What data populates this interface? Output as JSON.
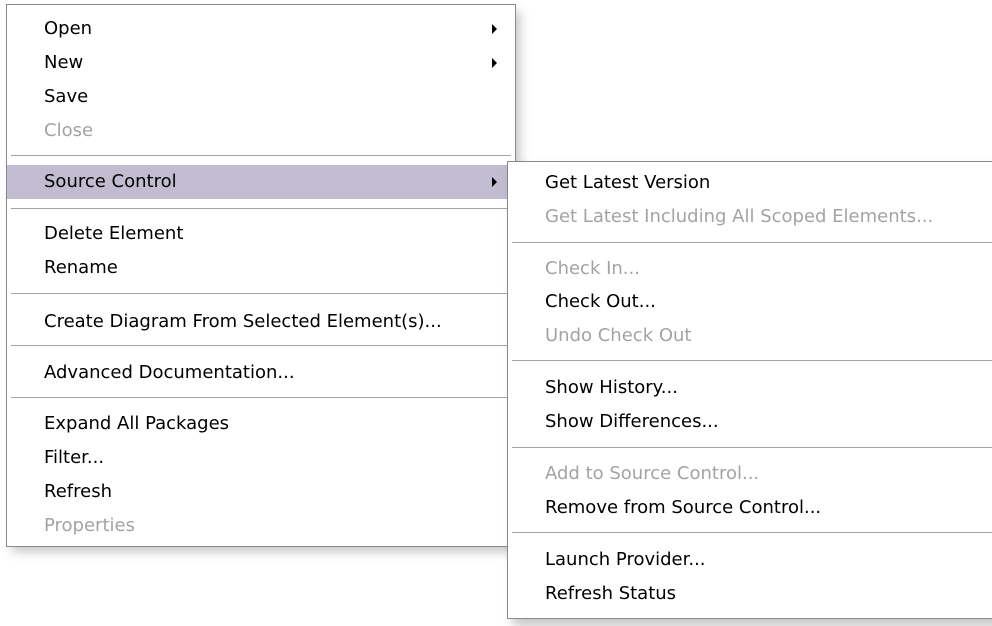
{
  "main_menu": {
    "items": [
      {
        "label": "Open",
        "disabled": false,
        "submenu": true
      },
      {
        "label": "New",
        "disabled": false,
        "submenu": true
      },
      {
        "label": "Save",
        "disabled": false,
        "submenu": false
      },
      {
        "label": "Close",
        "disabled": true,
        "submenu": false
      },
      {
        "label": "Source Control",
        "disabled": false,
        "submenu": true,
        "selected": true
      },
      {
        "label": "Delete Element",
        "disabled": false,
        "submenu": false
      },
      {
        "label": "Rename",
        "disabled": false,
        "submenu": false
      },
      {
        "label": "Create Diagram From Selected Element(s)...",
        "disabled": false,
        "submenu": false
      },
      {
        "label": "Advanced Documentation...",
        "disabled": false,
        "submenu": false
      },
      {
        "label": "Expand All Packages",
        "disabled": false,
        "submenu": false
      },
      {
        "label": "Filter...",
        "disabled": false,
        "submenu": false
      },
      {
        "label": "Refresh",
        "disabled": false,
        "submenu": false
      },
      {
        "label": "Properties",
        "disabled": true,
        "submenu": false
      }
    ]
  },
  "source_control_menu": {
    "items": [
      {
        "label": "Get Latest Version",
        "disabled": false
      },
      {
        "label": "Get Latest Including All Scoped Elements...",
        "disabled": true
      },
      {
        "label": "Check In...",
        "disabled": true
      },
      {
        "label": "Check Out...",
        "disabled": false
      },
      {
        "label": "Undo Check Out",
        "disabled": true
      },
      {
        "label": "Show History...",
        "disabled": false
      },
      {
        "label": "Show Differences...",
        "disabled": false
      },
      {
        "label": "Add to Source Control...",
        "disabled": true
      },
      {
        "label": "Remove from Source Control...",
        "disabled": false
      },
      {
        "label": "Launch Provider...",
        "disabled": false
      },
      {
        "label": "Refresh Status",
        "disabled": false
      }
    ]
  },
  "colors": {
    "selected_background": "#c1bccf",
    "disabled_text": "#a3a3a3",
    "border": "#8a8a8a"
  }
}
